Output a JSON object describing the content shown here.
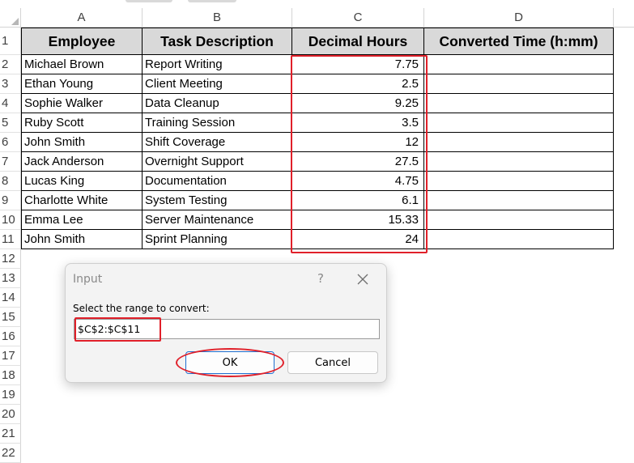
{
  "columns": [
    "A",
    "B",
    "C",
    "D"
  ],
  "row_numbers": [
    "1",
    "2",
    "3",
    "4",
    "5",
    "6",
    "7",
    "8",
    "9",
    "10",
    "11",
    "12",
    "13",
    "14",
    "15",
    "16",
    "17",
    "18",
    "19",
    "20",
    "21",
    "22"
  ],
  "table": {
    "headers": [
      "Employee",
      "Task Description",
      "Decimal Hours",
      "Converted Time (h:mm)"
    ],
    "rows": [
      [
        "Michael Brown",
        "Report Writing",
        "7.75",
        ""
      ],
      [
        "Ethan Young",
        "Client Meeting",
        "2.5",
        ""
      ],
      [
        "Sophie Walker",
        "Data Cleanup",
        "9.25",
        ""
      ],
      [
        "Ruby Scott",
        "Training Session",
        "3.5",
        ""
      ],
      [
        "John Smith",
        "Shift Coverage",
        "12",
        ""
      ],
      [
        "Jack Anderson",
        "Overnight Support",
        "27.5",
        ""
      ],
      [
        "Lucas King",
        "Documentation",
        "4.75",
        ""
      ],
      [
        "Charlotte White",
        "System Testing",
        "6.1",
        ""
      ],
      [
        "Emma Lee",
        "Server Maintenance",
        "15.33",
        ""
      ],
      [
        "John Smith",
        "Sprint Planning",
        "24",
        ""
      ]
    ]
  },
  "dialog": {
    "title": "Input",
    "help_glyph": "?",
    "close_icon": "close-icon",
    "prompt": "Select the range to convert:",
    "range_value": "$C$2:$C$11",
    "ok_label": "OK",
    "cancel_label": "Cancel"
  },
  "colors": {
    "header_fill": "#d9d9d9",
    "highlight_red": "#e0202a",
    "ok_border": "#1f6fd0"
  }
}
